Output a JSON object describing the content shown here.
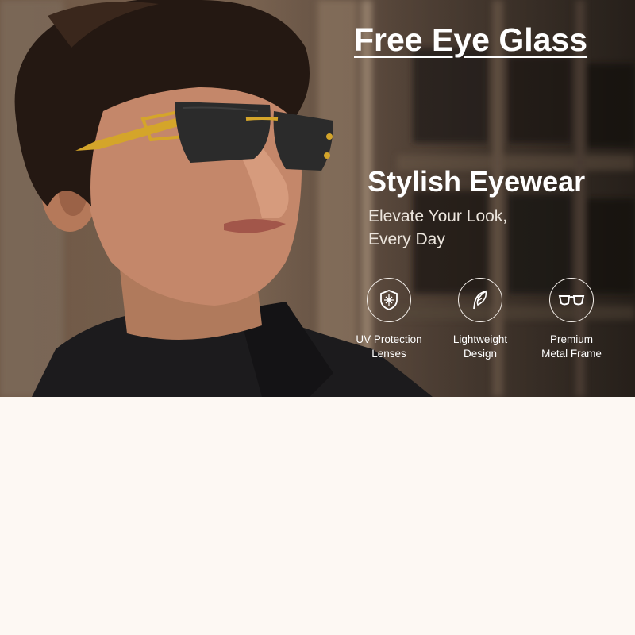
{
  "banner": {
    "title": "Free Eye Glass",
    "headline": "Stylish Eyewear",
    "tagline_line1": "Elevate Your Look,",
    "tagline_line2": "Every Day"
  },
  "features": [
    {
      "icon": "shield-icon",
      "line1": "UV Protection",
      "line2": "Lenses"
    },
    {
      "icon": "feather-icon",
      "line1": "Lightweight",
      "line2": "Design"
    },
    {
      "icon": "glasses-icon",
      "line1": "Premium",
      "line2": "Metal Frame"
    }
  ],
  "colors": {
    "page_background": "#fdf8f3",
    "text": "#ffffff",
    "frame_gold": "#d4a52a",
    "lens": "#2b2b2b"
  }
}
